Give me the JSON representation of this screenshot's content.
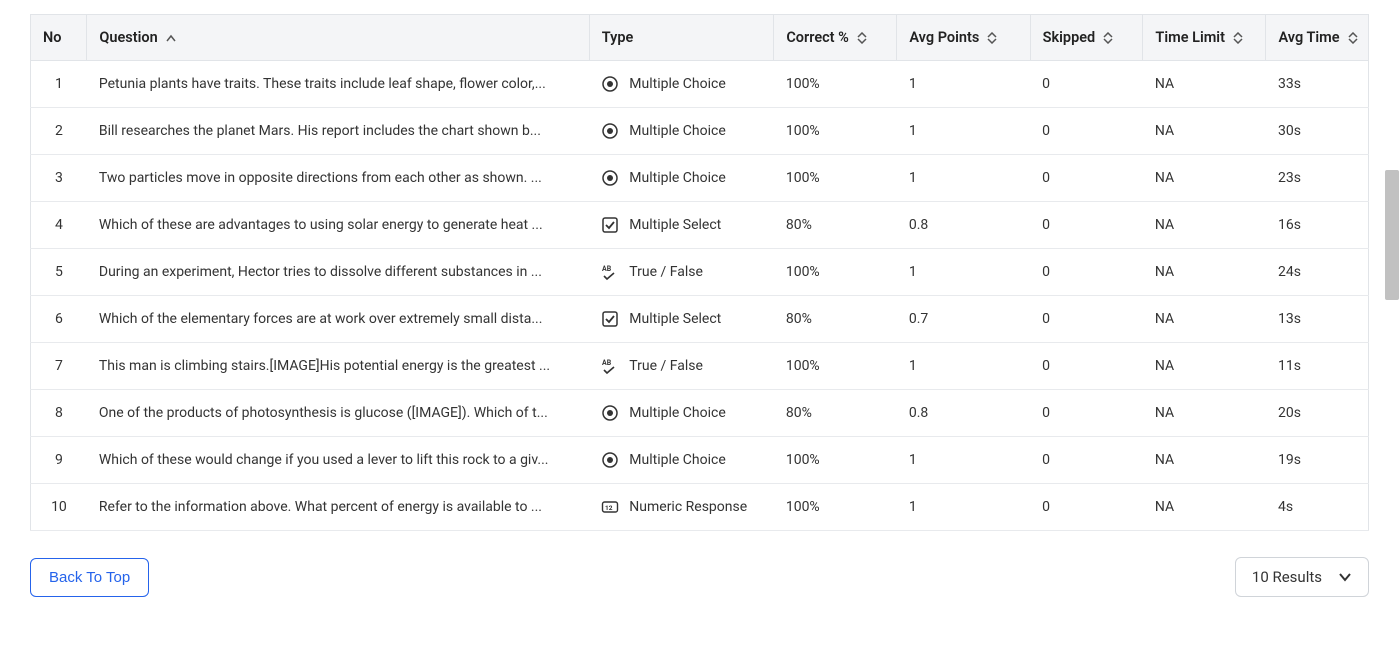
{
  "headers": {
    "no": "No",
    "question": "Question",
    "type": "Type",
    "correct": "Correct %",
    "avg_points": "Avg Points",
    "skipped": "Skipped",
    "time_limit": "Time Limit",
    "avg_time": "Avg Time"
  },
  "type_labels": {
    "multiple_choice": "Multiple Choice",
    "multiple_select": "Multiple Select",
    "true_false": "True / False",
    "numeric_response": "Numeric Response"
  },
  "rows": [
    {
      "no": "1",
      "question": "Petunia plants have traits. These traits include leaf shape, flower color,...",
      "type": "multiple_choice",
      "correct": "100%",
      "avg_points": "1",
      "skipped": "0",
      "time_limit": "NA",
      "avg_time": "33s"
    },
    {
      "no": "2",
      "question": "Bill researches the planet Mars. His report includes the chart shown b...",
      "type": "multiple_choice",
      "correct": "100%",
      "avg_points": "1",
      "skipped": "0",
      "time_limit": "NA",
      "avg_time": "30s"
    },
    {
      "no": "3",
      "question": "Two particles move in opposite directions from each other as shown. ...",
      "type": "multiple_choice",
      "correct": "100%",
      "avg_points": "1",
      "skipped": "0",
      "time_limit": "NA",
      "avg_time": "23s"
    },
    {
      "no": "4",
      "question": "Which of these are advantages to using solar energy to generate heat ...",
      "type": "multiple_select",
      "correct": "80%",
      "avg_points": "0.8",
      "skipped": "0",
      "time_limit": "NA",
      "avg_time": "16s"
    },
    {
      "no": "5",
      "question": "During an experiment, Hector tries to dissolve different substances in ...",
      "type": "true_false",
      "correct": "100%",
      "avg_points": "1",
      "skipped": "0",
      "time_limit": "NA",
      "avg_time": "24s"
    },
    {
      "no": "6",
      "question": "Which of the elementary forces are at work over extremely small dista...",
      "type": "multiple_select",
      "correct": "80%",
      "avg_points": "0.7",
      "skipped": "0",
      "time_limit": "NA",
      "avg_time": "13s"
    },
    {
      "no": "7",
      "question": "This man is climbing stairs.[IMAGE]His potential energy is the greatest ...",
      "type": "true_false",
      "correct": "100%",
      "avg_points": "1",
      "skipped": "0",
      "time_limit": "NA",
      "avg_time": "11s"
    },
    {
      "no": "8",
      "question": "One of the products of photosynthesis is glucose ([IMAGE]). Which of t...",
      "type": "multiple_choice",
      "correct": "80%",
      "avg_points": "0.8",
      "skipped": "0",
      "time_limit": "NA",
      "avg_time": "20s"
    },
    {
      "no": "9",
      "question": "Which of these would change if you used a lever to lift this rock to a giv...",
      "type": "multiple_choice",
      "correct": "100%",
      "avg_points": "1",
      "skipped": "0",
      "time_limit": "NA",
      "avg_time": "19s"
    },
    {
      "no": "10",
      "question": "Refer to the information above. What percent of energy is available to ...",
      "type": "numeric_response",
      "correct": "100%",
      "avg_points": "1",
      "skipped": "0",
      "time_limit": "NA",
      "avg_time": "4s"
    }
  ],
  "footer": {
    "back_to_top": "Back To Top",
    "results_label": "10 Results"
  }
}
